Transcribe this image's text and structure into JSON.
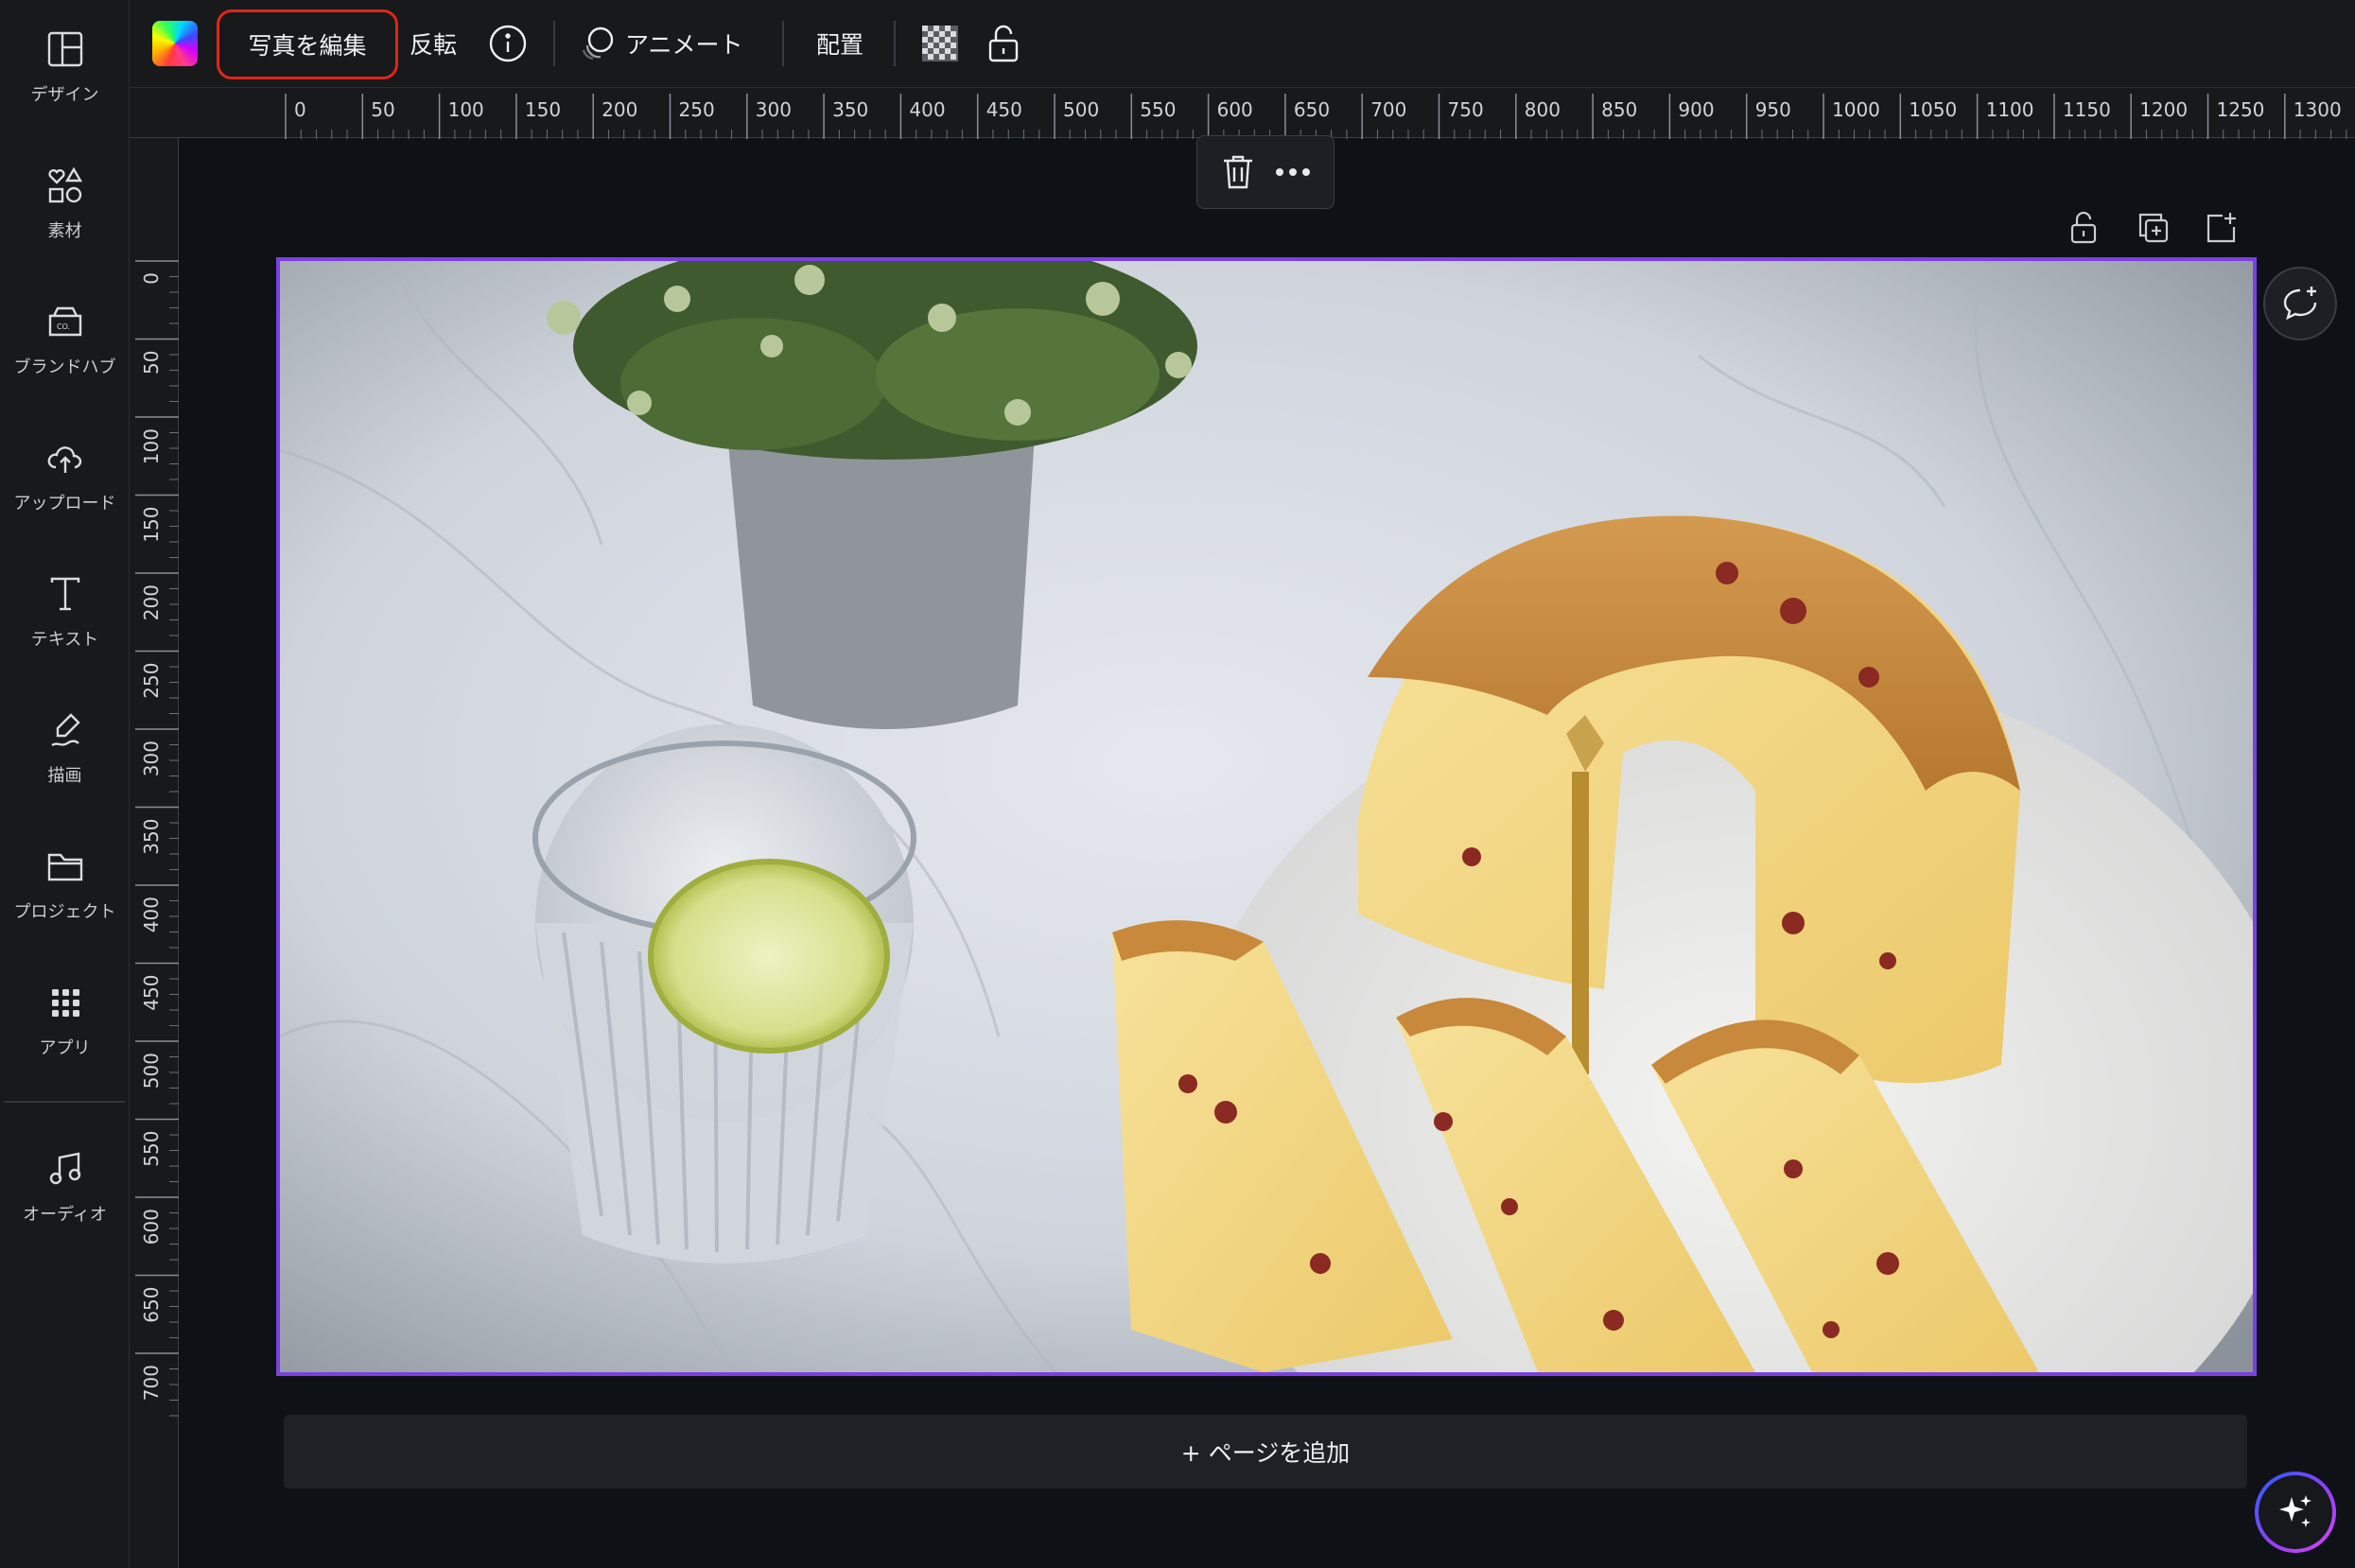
{
  "sidebar": {
    "items": [
      {
        "label": "デザイン",
        "icon": "layout-icon"
      },
      {
        "label": "素材",
        "icon": "shapes-icon"
      },
      {
        "label": "ブランドハブ",
        "icon": "brand-hub-icon"
      },
      {
        "label": "アップロード",
        "icon": "cloud-upload-icon"
      },
      {
        "label": "テキスト",
        "icon": "text-icon"
      },
      {
        "label": "描画",
        "icon": "draw-icon"
      },
      {
        "label": "プロジェクト",
        "icon": "folder-icon"
      },
      {
        "label": "アプリ",
        "icon": "apps-grid-icon"
      },
      {
        "label": "オーディオ",
        "icon": "music-note-icon"
      }
    ]
  },
  "toolbar": {
    "edit_photo": "写真を編集",
    "flip": "反転",
    "animate": "アニメート",
    "position": "配置"
  },
  "ruler": {
    "top_labels": [
      "0",
      "50",
      "100",
      "150",
      "200",
      "250",
      "300",
      "350",
      "400",
      "450",
      "500",
      "550",
      "600",
      "650",
      "700",
      "750",
      "800",
      "850",
      "900",
      "950",
      "1000",
      "1050",
      "1100",
      "1150",
      "1200",
      "1250",
      "1300"
    ],
    "left_labels": [
      "0",
      "50",
      "100",
      "150",
      "200",
      "250",
      "300",
      "350",
      "400",
      "450",
      "500",
      "550",
      "600",
      "650",
      "700"
    ]
  },
  "canvas": {
    "add_page": "+ ページを追加"
  },
  "colors": {
    "selection": "#7b3fe4",
    "highlight": "#e0261c",
    "background": "#0e1216",
    "panel": "#18191b"
  }
}
